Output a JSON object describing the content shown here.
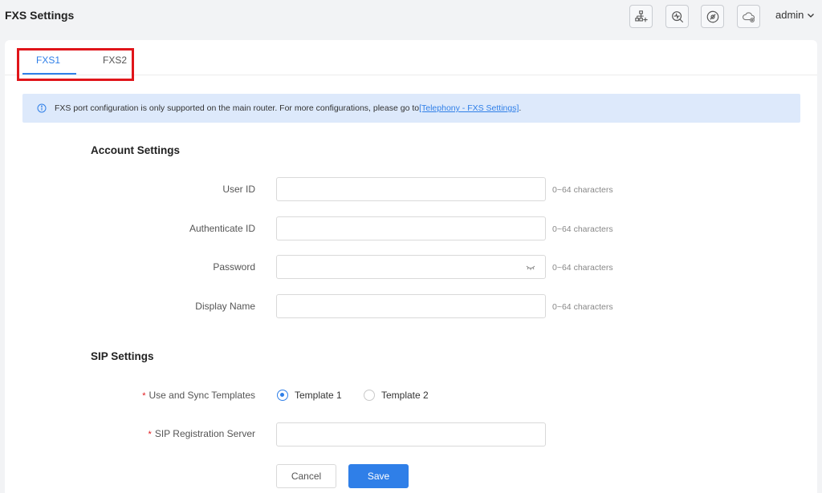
{
  "header": {
    "title": "FXS Settings",
    "user": "admin",
    "toolbar_icons": [
      "network-add-icon",
      "diagnose-icon",
      "compass-icon",
      "cloud-icon"
    ]
  },
  "tabs": [
    {
      "label": "FXS1",
      "active": true
    },
    {
      "label": "FXS2",
      "active": false
    }
  ],
  "banner": {
    "text": "FXS port configuration is only supported on the main router. For more configurations, please go to ",
    "link": "[Telephony - FXS Settings]",
    "suffix": "."
  },
  "account": {
    "title": "Account Settings",
    "fields": [
      {
        "label": "User ID",
        "value": "",
        "hint": "0~64 characters"
      },
      {
        "label": "Authenticate ID",
        "value": "",
        "hint": "0~64 characters"
      },
      {
        "label": "Password",
        "value": "",
        "hint": "0~64 characters"
      },
      {
        "label": "Display Name",
        "value": "",
        "hint": "0~64 characters"
      }
    ]
  },
  "sip": {
    "title": "SIP Settings",
    "templates_label": "Use and Sync Templates",
    "templates": [
      {
        "label": "Template 1",
        "checked": true
      },
      {
        "label": "Template 2",
        "checked": false
      }
    ],
    "server_label": "SIP Registration Server",
    "server_value": ""
  },
  "actions": {
    "cancel": "Cancel",
    "save": "Save"
  },
  "colors": {
    "accent": "#2f7fe8",
    "highlight": "#e0151a",
    "banner_bg": "#dde9fb"
  }
}
